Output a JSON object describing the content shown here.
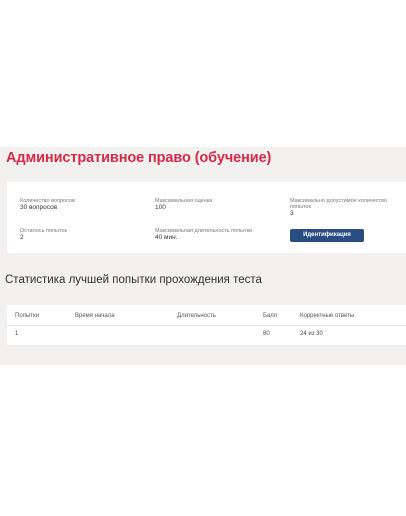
{
  "header": {
    "title": "Административное право (обучение)"
  },
  "info": {
    "question_count_label": "Количество вопросов",
    "question_count_value": "30 вопросов",
    "max_score_label": "Максимальная оценка",
    "max_score_value": "100",
    "max_attempts_label": "Максимально допустимое количество попыток",
    "max_attempts_value": "3",
    "attempts_left_label": "Осталось попыток",
    "attempts_left_value": "2",
    "max_duration_label": "Максимальная длительность попытки",
    "max_duration_value": "40 мин.",
    "identify_button": "Идентификация"
  },
  "stats": {
    "title": "Статистика лучшей попытки прохождения теста",
    "columns": [
      "Попытки",
      "Время начала",
      "Длительность",
      "Балл",
      "Корректные ответы"
    ],
    "rows": [
      [
        "1",
        "",
        "",
        "80",
        "24 из 30"
      ]
    ]
  },
  "colors": {
    "title": "#d42a4a",
    "button": "#284d82",
    "band": "#f2f1ef"
  }
}
